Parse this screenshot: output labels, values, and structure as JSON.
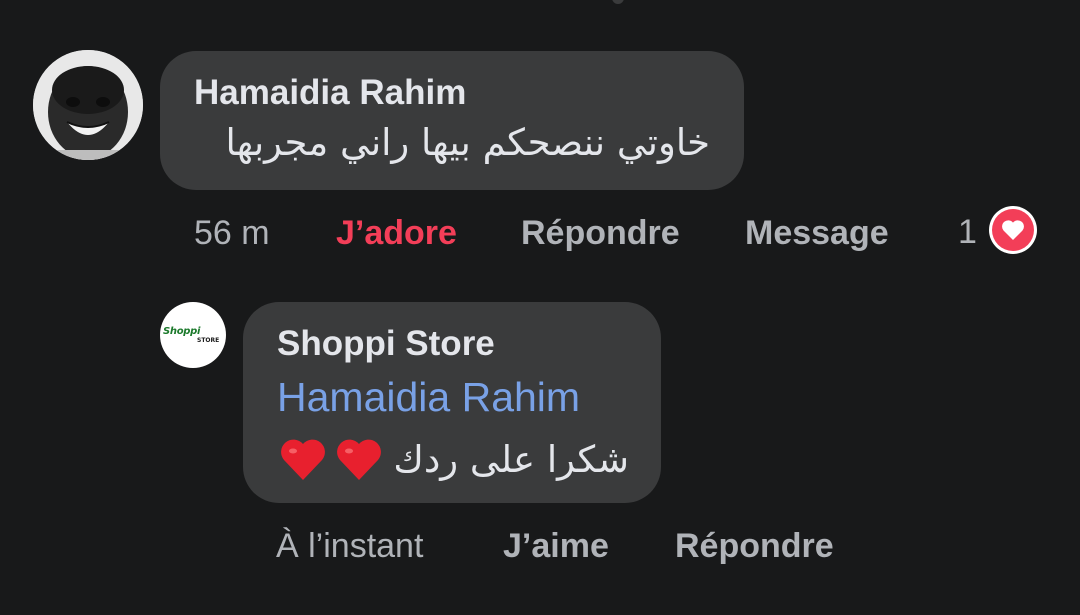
{
  "comment": {
    "author": "Hamaidia Rahim",
    "text": "خاوتي ننصحكم بيها راني مجربها",
    "time": "56 m",
    "actions": {
      "reaction": "J’adore",
      "reply": "Répondre",
      "message": "Message"
    },
    "reaction_count": "1",
    "reaction_icon": "heart-icon",
    "reaction_color": "#f33e58"
  },
  "reply": {
    "author": "Shoppi Store",
    "mention": "Hamaidia Rahim",
    "text": "شكرا على ردك",
    "emoji": "heart-emoji",
    "emoji_count": 2,
    "time": "À l’instant",
    "actions": {
      "like": "J’aime",
      "reply": "Répondre"
    },
    "avatar_logo": "Shoppi",
    "avatar_logo_sub": "STORE"
  },
  "colors": {
    "background": "#18191a",
    "bubble": "#3a3b3c",
    "mention": "#79a1e6",
    "secondary_text": "#b0b3b8"
  }
}
